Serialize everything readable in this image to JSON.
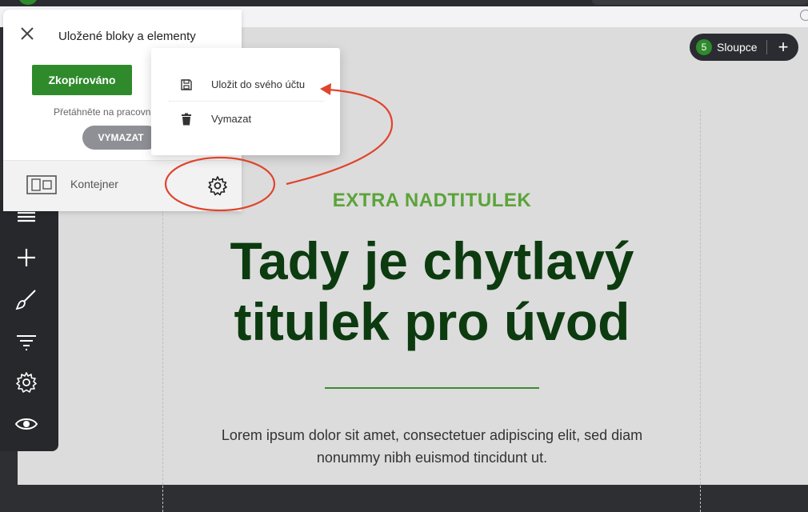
{
  "saved_panel": {
    "title": "Uložené bloky a elementy",
    "copied_button": "Zkopírováno",
    "hint": "Přetáhněte na pracovní",
    "clear_button": "VYMAZAT",
    "item_label": "Kontejner"
  },
  "context_menu": {
    "save_label": "Uložit do svého účtu",
    "delete_label": "Vymazat"
  },
  "columns_pill": {
    "count": "5",
    "label": "Sloupce",
    "add": "+"
  },
  "hero": {
    "kicker": "EXTRA NADTITULEK",
    "title": "Tady je chytlavý titulek pro úvod",
    "text": "Lorem ipsum dolor sit amet, consectetuer adipiscing elit, sed diam nonummy nibh euismod tincidunt ut."
  },
  "colors": {
    "brand_green": "#2f8a2c",
    "kicker_green": "#5ba33a",
    "title_green": "#0c3b10",
    "annotation_red": "#e0442e"
  },
  "icons": {
    "close": "close-icon",
    "gear": "gear-icon",
    "save": "floppy-icon",
    "delete": "trash-icon",
    "container": "container-icon",
    "sidebar": [
      "menu-icon",
      "plus-icon",
      "brush-icon",
      "filter-icon",
      "gear-icon",
      "eye-icon"
    ]
  }
}
